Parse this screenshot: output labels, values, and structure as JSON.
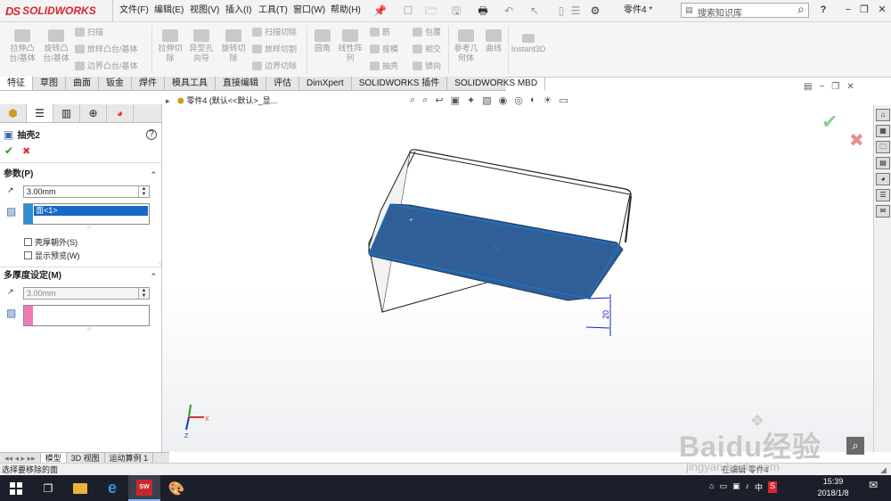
{
  "app": {
    "brand": "SOLIDWORKS",
    "brand_mark": "DS"
  },
  "menu": [
    "文件(F)",
    "编辑(E)",
    "视图(V)",
    "插入(I)",
    "工具(T)",
    "窗口(W)",
    "帮助(H)"
  ],
  "document_name": "零件4 *",
  "search": {
    "placeholder": "搜索知识库"
  },
  "ribbon": {
    "big": [
      {
        "label": "拉伸凸\n台/基体"
      },
      {
        "label": "旋转凸\n台/基体"
      },
      {
        "label": "拉伸切\n除"
      },
      {
        "label": "异型孔\n向导"
      },
      {
        "label": "旋转切\n除"
      },
      {
        "label": "圆角"
      },
      {
        "label": "线性阵\n列"
      },
      {
        "label": "参考几\n何体"
      },
      {
        "label": "曲线"
      },
      {
        "label": "Instant3D"
      }
    ],
    "small_a": [
      "扫描",
      "放样凸台/基体",
      "边界凸台/基体"
    ],
    "small_b": [
      "扫描切除",
      "放样切割",
      "边界切除"
    ],
    "small_c": [
      "筋",
      "拔模",
      "抽壳"
    ],
    "small_d": [
      "包覆",
      "相交",
      "镜向"
    ]
  },
  "tabs": [
    "特征",
    "草图",
    "曲面",
    "钣金",
    "焊件",
    "模具工具",
    "直接编辑",
    "评估",
    "DimXpert",
    "SOLIDWORKS 插件",
    "SOLIDWORKS MBD"
  ],
  "property_manager": {
    "title": "抽壳2",
    "params_header": "参数(P)",
    "thickness": "3.00mm",
    "faces_item": "面<1>",
    "shell_outward": "壳厚朝外(S)",
    "show_preview": "显示预览(W)",
    "multi_header": "多厚度设定(M)",
    "multi_thickness": "3.00mm"
  },
  "viewport": {
    "breadcrumb": "零件4 (默认<<默认>_显...",
    "dimension": "20"
  },
  "bottom_tabs": [
    "模型",
    "3D 视图",
    "运动算例 1"
  ],
  "status": {
    "message": "选择要移除的面",
    "right": "在编辑 零件4"
  },
  "taskbar": {
    "time": "15:39",
    "date": "2018/1/8",
    "ime": "中"
  },
  "watermark": {
    "brand": "Baidu经验",
    "url": "jingyan.baidu.com"
  },
  "colors": {
    "brand_red": "#d8262f",
    "selection_blue": "#2f5f96",
    "accent": "#1b7bd0"
  }
}
